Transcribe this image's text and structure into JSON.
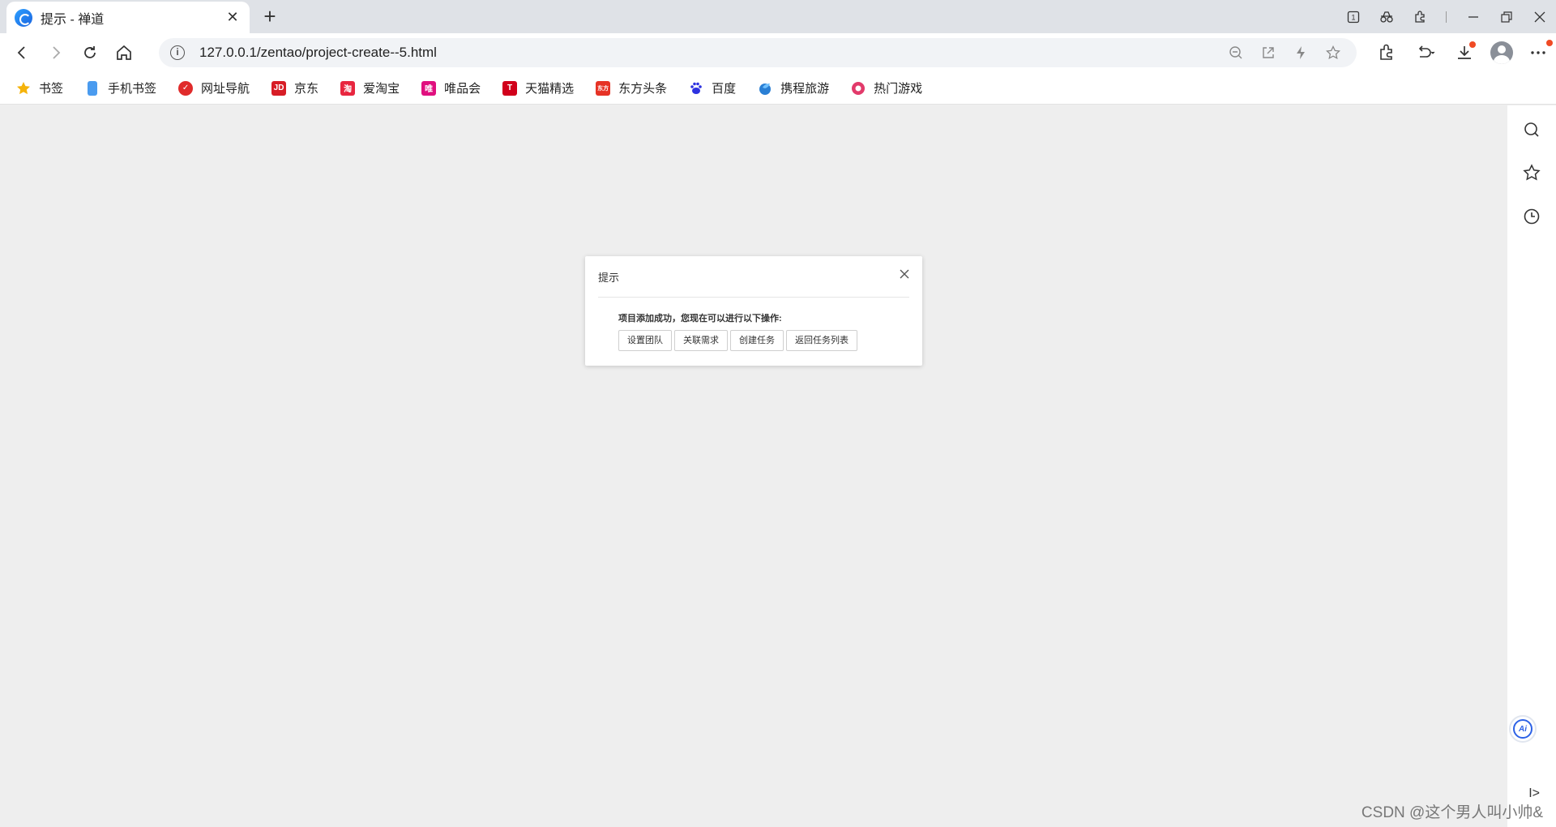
{
  "browser": {
    "tab_title": "提示 - 禅道",
    "tab_close": "✕",
    "new_tab": "+",
    "url": "127.0.0.1/zentao/project-create--5.html"
  },
  "bookmarks": [
    {
      "label": "书签",
      "icon": "star-icon",
      "color": "#f5b30b"
    },
    {
      "label": "手机书签",
      "icon": "phone-icon",
      "color": "#4a9bef"
    },
    {
      "label": "网址导航",
      "icon": "nav-icon",
      "color": "#e02b2b"
    },
    {
      "label": "京东",
      "icon": "jd-icon",
      "color": "#d71d26"
    },
    {
      "label": "爱淘宝",
      "icon": "taobao-icon",
      "color": "#e8263f"
    },
    {
      "label": "唯品会",
      "icon": "vip-icon",
      "color": "#e0107f"
    },
    {
      "label": "天猫精选",
      "icon": "tmall-icon",
      "color": "#d1001b"
    },
    {
      "label": "东方头条",
      "icon": "dftt-icon",
      "color": "#e63225"
    },
    {
      "label": "百度",
      "icon": "baidu-icon",
      "color": "#2d32e0"
    },
    {
      "label": "携程旅游",
      "icon": "ctrip-icon",
      "color": "#2a7fd4"
    },
    {
      "label": "热门游戏",
      "icon": "game-icon",
      "color": "#e23a6a"
    }
  ],
  "dialog": {
    "title": "提示",
    "message": "项目添加成功，您现在可以进行以下操作:",
    "buttons": [
      "设置团队",
      "关联需求",
      "创建任务",
      "返回任务列表"
    ]
  },
  "side_panel": {
    "ai_label": "Ai",
    "collapse_label": "I>"
  },
  "watermark": "CSDN @这个男人叫小帅&"
}
